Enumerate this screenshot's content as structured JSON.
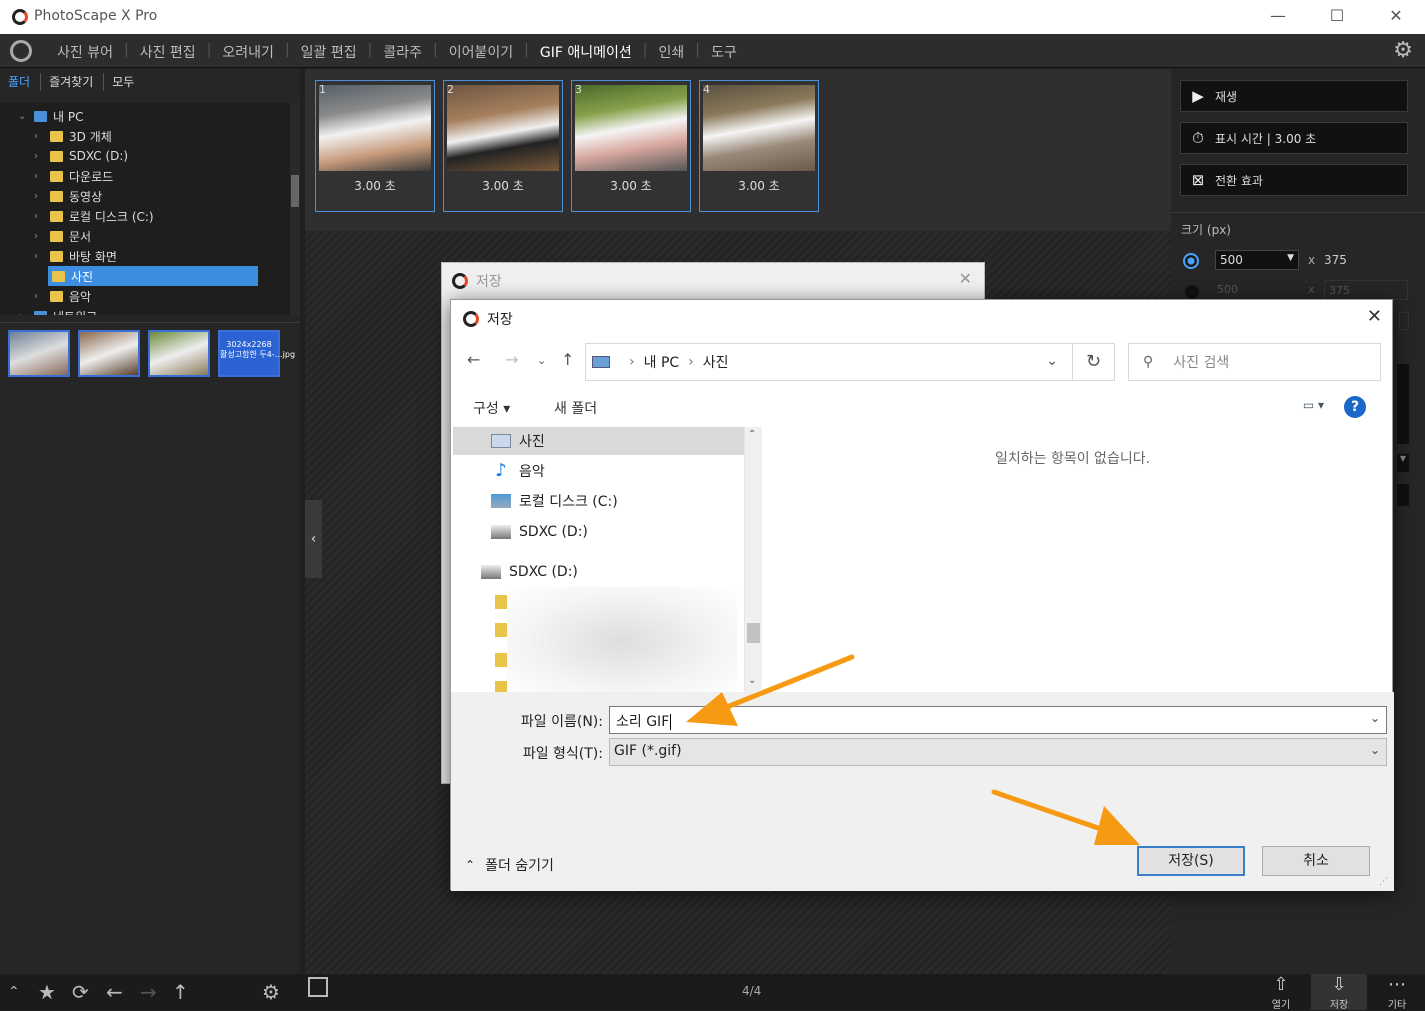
{
  "app": {
    "title": "PhotoScape X Pro",
    "window_buttons": [
      "—",
      "☐",
      "✕"
    ]
  },
  "menu": {
    "items": [
      "사진 뷰어",
      "사진 편집",
      "오려내기",
      "일괄 편집",
      "콜라주",
      "이어붙이기",
      "GIF 애니메이션",
      "인쇄",
      "도구"
    ],
    "active": "GIF 애니메이션"
  },
  "left_panel": {
    "tabs": [
      "폴더",
      "즐겨찾기",
      "모두"
    ],
    "tree": [
      {
        "label": "내 PC",
        "level": 0,
        "expanded": true
      },
      {
        "label": "3D 개체",
        "level": 1
      },
      {
        "label": "SDXC (D:)",
        "level": 1
      },
      {
        "label": "다운로드",
        "level": 1
      },
      {
        "label": "동영상",
        "level": 1
      },
      {
        "label": "로컬 디스크 (C:)",
        "level": 1
      },
      {
        "label": "문서",
        "level": 1
      },
      {
        "label": "바탕 화면",
        "level": 1
      },
      {
        "label": "사진",
        "level": 1,
        "selected": true
      },
      {
        "label": "음악",
        "level": 1
      },
      {
        "label": "네트워크",
        "level": 0
      }
    ],
    "thumb_caption": "3024x2268\n활성고함한 두4-…jpg"
  },
  "frames": [
    {
      "num": "1",
      "duration": "3.00 초"
    },
    {
      "num": "2",
      "duration": "3.00 초"
    },
    {
      "num": "3",
      "duration": "3.00 초"
    },
    {
      "num": "4",
      "duration": "3.00 초"
    }
  ],
  "right_panel": {
    "play": "재생",
    "display_time": "표시 시간 | 3.00 초",
    "transition": "전환 효과",
    "size_label": "크기 (px)",
    "width": "500",
    "height": "375",
    "x": "x",
    "width_dim": "500",
    "height_dim": "375"
  },
  "bottom_bar": {
    "page_count": "4/4",
    "open": "열기",
    "save": "저장",
    "more": "기타"
  },
  "back_dialog": {
    "title": "저장"
  },
  "save_dialog": {
    "title": "저장",
    "path": [
      "내 PC",
      "사진"
    ],
    "search_placeholder": "사진 검색",
    "organize": "구성 ▾",
    "new_folder": "새 폴더",
    "nav_items": [
      "사진",
      "음악",
      "로컬 디스크 (C:)",
      "SDXC (D:)",
      "SDXC (D:)"
    ],
    "empty_message": "일치하는 항목이 없습니다.",
    "filename_label": "파일 이름(N):",
    "filename_value": "소리 GIF",
    "filetype_label": "파일 형식(T):",
    "filetype_value": "GIF (*.gif)",
    "save_button": "저장(S)",
    "cancel_button": "취소",
    "hide_folders": "폴더 숨기기"
  },
  "colors": {
    "accent": "#3d8ee0",
    "arrow": "#f59a12",
    "dialog_save_border": "#3c7fc8"
  }
}
